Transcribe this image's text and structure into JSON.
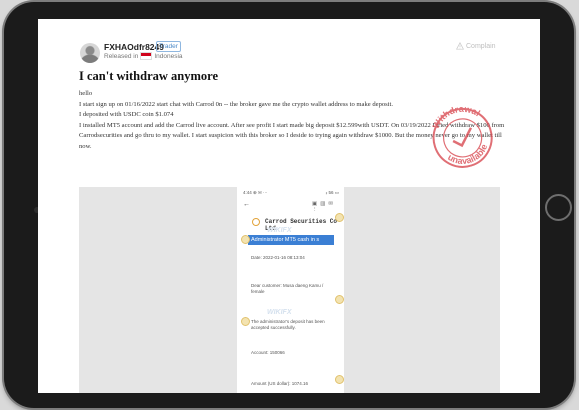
{
  "post": {
    "username": "FXHAOdfr8249",
    "user_tag": "Trader",
    "released_prefix": "Released in",
    "country": "Indonesia",
    "complain_label": "Complain",
    "title": "I can't withdraw anymore",
    "paragraphs": [
      "hello",
      "I start sign up on 01/16/2022 start chat with Carrod 0n -- the broker gave me the crypto wallet address to make deposit.",
      "I deposited with USDC coin $1.074",
      "I installed MT5 account and add the Carrod live account. After see profit I start made big deposit $12.599with USDT. On 03/19/2022 I tried withdraw $100 from Carrodsecurities and go thru to my wallet. I start suspicion with this broker so I deside to trying again withdraw $1000. But the money never go to my wallet till now."
    ]
  },
  "stamp": {
    "line1": "Withdrawal",
    "line2": "unavailable"
  },
  "phone": {
    "status_left": "4:44 ⊕ ✉ ···",
    "status_right": "ᵢₗ 56 ▭",
    "company": "Carrod Securities Co Ltd",
    "banner": "Administrator MT5 cash in s",
    "watermark": "WIKIFX",
    "date": "Date: 2022-01-16 08:13:04",
    "greeting": "Dear customer: Musa daeng Kamu / female",
    "confirm": "The administrator's deposit has been accepted successfully.",
    "account": "Account: 150066",
    "amount": "Amount (US dollar): 1074.16"
  }
}
